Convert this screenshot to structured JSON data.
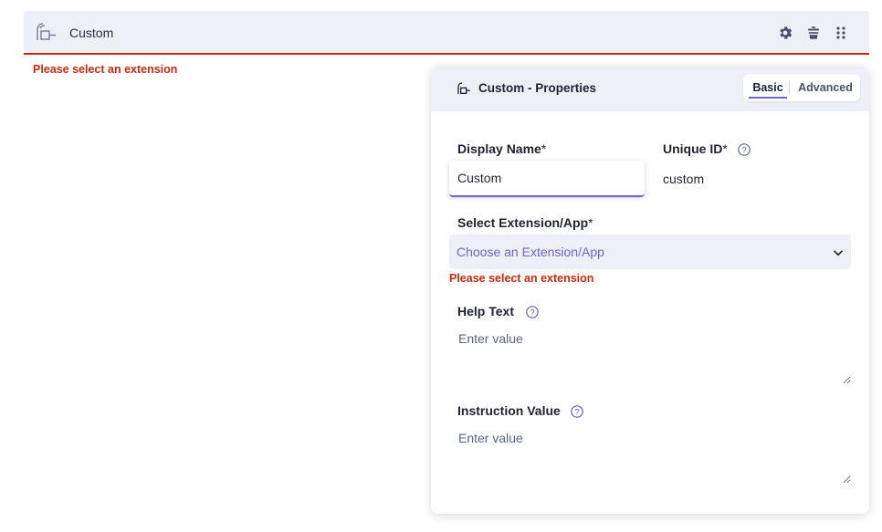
{
  "field_bar": {
    "title": "Custom",
    "type_icon": "custom-field-icon",
    "actions": [
      "gear-icon",
      "trash-icon",
      "drag-handle-icon"
    ],
    "error": "Please select an extension"
  },
  "properties": {
    "title": "Custom - Properties",
    "header_icon": "custom-field-icon",
    "tabs": [
      "Basic",
      "Advanced"
    ],
    "active_tab": "Basic",
    "display_name": {
      "label": "Display Name",
      "required_mark": "*",
      "value": "Custom"
    },
    "unique_id": {
      "label": "Unique ID",
      "required_mark": "*",
      "value": "custom",
      "help_icon": "help-circle-icon"
    },
    "extension": {
      "label": "Select Extension/App",
      "required_mark": "*",
      "placeholder": "Choose an Extension/App",
      "error": "Please select an extension"
    },
    "help_text": {
      "label": "Help Text",
      "placeholder": "Enter value",
      "help_icon": "help-circle-icon"
    },
    "instruction_value": {
      "label": "Instruction Value",
      "placeholder": "Enter value",
      "help_icon": "help-circle-icon"
    }
  },
  "colors": {
    "accent": "#6f63d9",
    "error": "#cf2a10",
    "header_bg": "#eef0f7"
  }
}
